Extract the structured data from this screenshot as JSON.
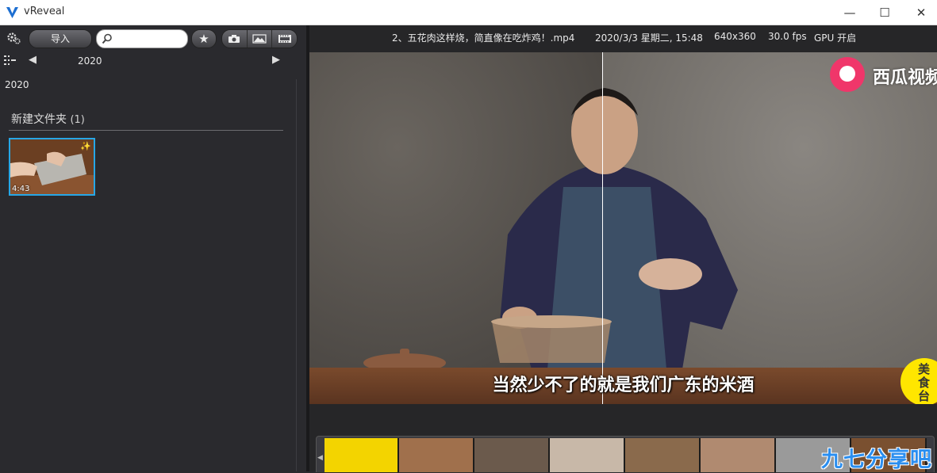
{
  "window": {
    "title": "vReveal",
    "minimize": "—",
    "maximize": "☐",
    "close": "✕"
  },
  "toolbar": {
    "import_label": "导入",
    "search_placeholder": "",
    "star_glyph": "★"
  },
  "nav": {
    "year": "2020",
    "prev": "◀",
    "next": "▶"
  },
  "library": {
    "year_label": "2020",
    "folder_name": "新建文件夹",
    "folder_count": "(1)",
    "thumbnails": [
      {
        "duration": "4:43",
        "magic": "✨"
      }
    ]
  },
  "info": {
    "filename": "2、五花肉这样烧，简直像在吃炸鸡！.mp4",
    "date": "2020/3/3 星期二, 15:48",
    "resolution": "640x360",
    "fps": "30.0 fps",
    "gpu": "GPU 开启"
  },
  "video": {
    "subtitle": "当然少不了的就是我们广东的米酒",
    "channel_logo_text": "西瓜视频",
    "corner_badge_text": "美食台"
  },
  "filmstrip": {
    "frame_colors": [
      "#f3d400",
      "#a0704c",
      "#6b5a4c",
      "#c8b8a8",
      "#8a6a4c",
      "#b08a70",
      "#9a9a9a",
      "#7a5030"
    ],
    "watermark_text": "九七分享吧"
  },
  "colors": {
    "selection_border": "#27a7e6",
    "logo_pink": "#f0366a",
    "badge_yellow": "#ffe600"
  }
}
